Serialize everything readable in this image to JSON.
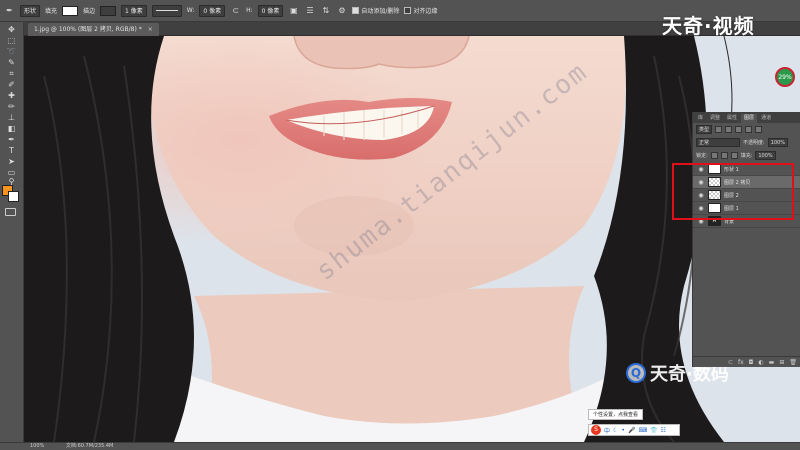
{
  "options_bar": {
    "shape_mode": "形状",
    "fill_label": "填充",
    "stroke_label": "描边",
    "stroke_size": "1 像素",
    "width_label": "W:",
    "width_value": "0 像素",
    "height_label": "H:",
    "height_value": "0 像素",
    "auto_add_delete": "自动添加/删除",
    "align_edges": "对齐边缘"
  },
  "document_tab": {
    "title": "1.jpg @ 100% (图层 2 拷贝, RGB/8) *",
    "close": "×"
  },
  "brand": {
    "top_logo": "天奇·视频",
    "watermark": "shuma.tianqijun.com",
    "bottom_logo": "天奇·数码",
    "bottom_logo_letter": "Q"
  },
  "badge": {
    "percent": "29%"
  },
  "layers_panel": {
    "tabs": [
      "库",
      "调整",
      "属性",
      "图层",
      "通道"
    ],
    "active_tab": "图层",
    "filter_kind": "类型",
    "blend_mode": "正常",
    "opacity_label": "不透明度:",
    "opacity_value": "100%",
    "lock_label": "锁定:",
    "fill_label": "填充:",
    "fill_value": "100%",
    "layers": [
      {
        "name": "形状 1",
        "thumb": "white",
        "selected": false
      },
      {
        "name": "图层 2 拷贝",
        "thumb": "checker",
        "selected": true
      },
      {
        "name": "图层 2",
        "thumb": "checker",
        "selected": false
      },
      {
        "name": "图层 1",
        "thumb": "white",
        "selected": false
      },
      {
        "name": "背景",
        "thumb": "dark",
        "selected": false
      }
    ],
    "footer_icons": [
      "link-icon",
      "fx-icon",
      "mask-icon",
      "adjust-icon",
      "folder-icon",
      "new-layer-icon",
      "trash-icon"
    ]
  },
  "status_bar": {
    "zoom": "100%",
    "doc_info": "文档:60.7M/235.4M"
  },
  "ime": {
    "tooltip": "个性设置，点我查看",
    "logo": "S"
  },
  "colors": {
    "foreground": "#f7931e",
    "background": "#ffffff",
    "highlight_box": "#e0101a"
  }
}
